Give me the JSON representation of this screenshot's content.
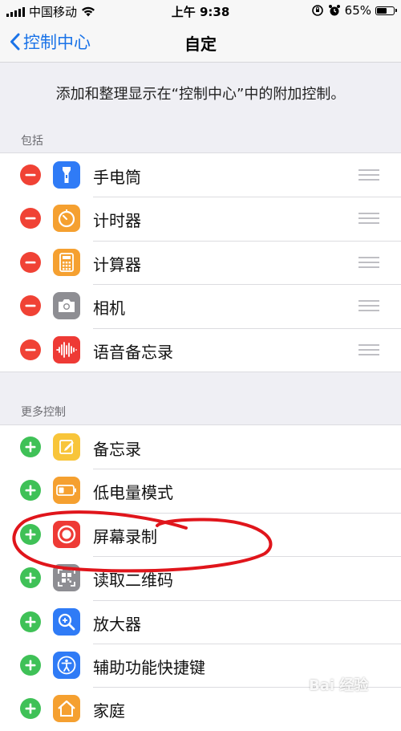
{
  "status_bar": {
    "carrier": "中国移动",
    "time": "上午 9:38",
    "battery_percent": "65%",
    "battery_level": 0.65
  },
  "nav": {
    "back_label": "控制中心",
    "title": "自定"
  },
  "description": "添加和整理显示在“控制中心”中的附加控制。",
  "included": {
    "header": "包括",
    "items": [
      {
        "label": "手电筒",
        "icon": "flashlight-icon",
        "color": "#2f7bf6"
      },
      {
        "label": "计时器",
        "icon": "timer-icon",
        "color": "#f5a030"
      },
      {
        "label": "计算器",
        "icon": "calculator-icon",
        "color": "#f5a030"
      },
      {
        "label": "相机",
        "icon": "camera-icon",
        "color": "#8e8e93"
      },
      {
        "label": "语音备忘录",
        "icon": "voice-memo-icon",
        "color": "#ee3a35"
      }
    ]
  },
  "more": {
    "header": "更多控制",
    "items": [
      {
        "label": "备忘录",
        "icon": "notes-icon",
        "color": "#f8c53a"
      },
      {
        "label": "低电量模式",
        "icon": "low-power-icon",
        "color": "#f5a030"
      },
      {
        "label": "屏幕录制",
        "icon": "screen-record-icon",
        "color": "#ee3a35"
      },
      {
        "label": "读取二维码",
        "icon": "qr-code-icon",
        "color": "#8e8e93"
      },
      {
        "label": "放大器",
        "icon": "magnifier-icon",
        "color": "#2f7bf6"
      },
      {
        "label": "辅助功能快捷键",
        "icon": "accessibility-icon",
        "color": "#2f7bf6"
      },
      {
        "label": "家庭",
        "icon": "home-icon",
        "color": "#f5a030"
      }
    ]
  },
  "watermark": "Bai 经验",
  "colors": {
    "accent": "#1a73e8",
    "remove": "#f04235",
    "add": "#3fc157",
    "annotation": "#e0151b"
  }
}
